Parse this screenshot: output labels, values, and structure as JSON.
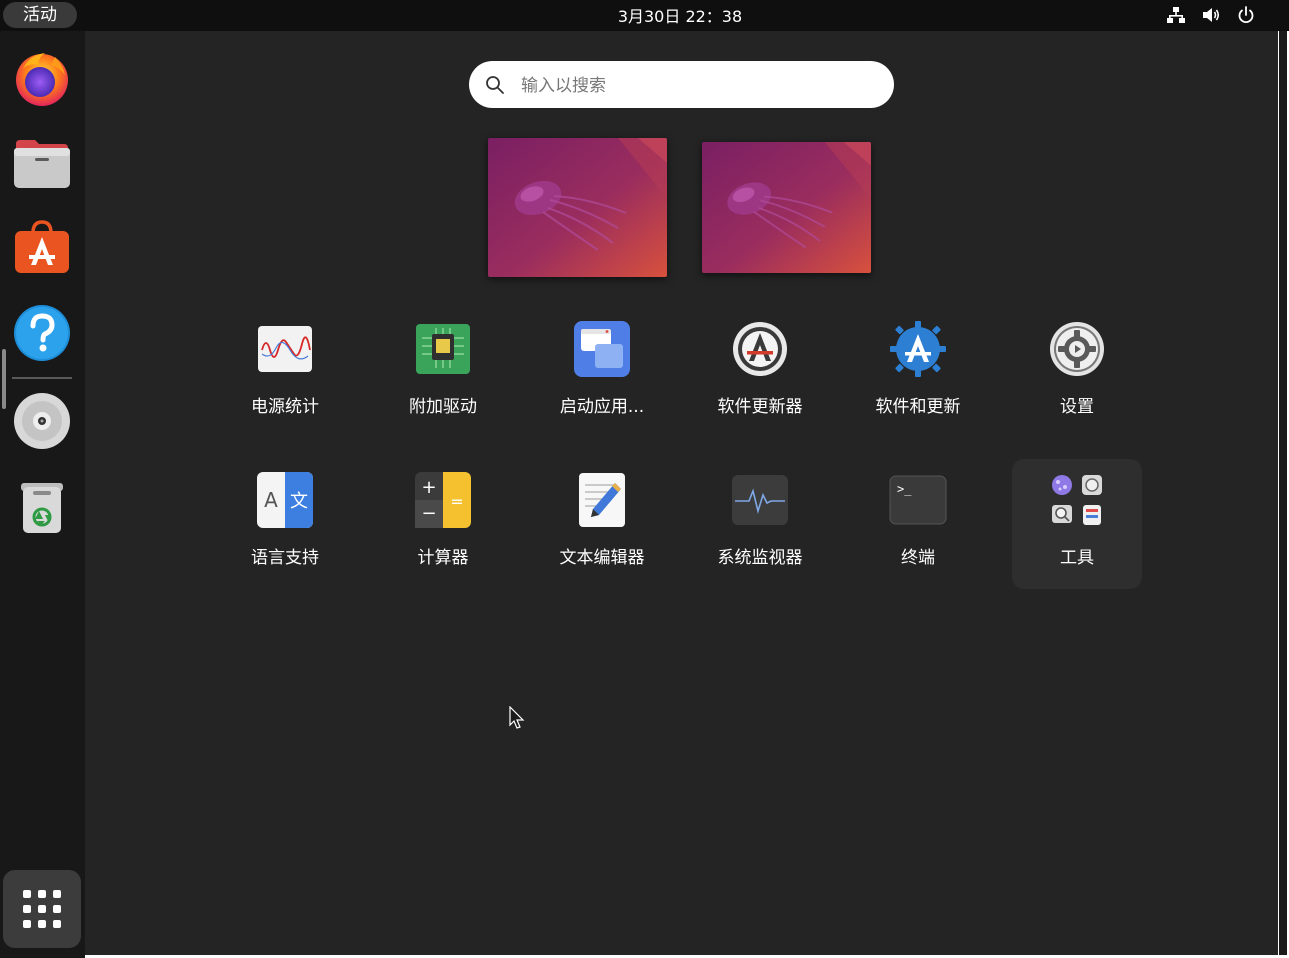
{
  "topbar": {
    "activities_label": "活动",
    "clock": "3月30日  22：38",
    "tray": [
      "network-icon",
      "volume-icon",
      "power-icon"
    ]
  },
  "dock": {
    "items": [
      "firefox-icon",
      "files-icon",
      "app-store-icon",
      "help-icon",
      "disc-icon",
      "trash-icon"
    ],
    "show_apps": "show-apps-grid-icon"
  },
  "search": {
    "placeholder": "输入以搜索"
  },
  "workspaces": [
    {
      "name": "workspace-1",
      "wallpaper": "jellyfish-purple"
    },
    {
      "name": "workspace-2",
      "wallpaper": "jellyfish-purple"
    }
  ],
  "apps": [
    {
      "label": "电源统计",
      "icon": "power-statistics-icon"
    },
    {
      "label": "附加驱动",
      "icon": "additional-drivers-icon"
    },
    {
      "label": "启动应用...",
      "icon": "startup-apps-icon"
    },
    {
      "label": "软件更新器",
      "icon": "software-updater-icon"
    },
    {
      "label": "软件和更新",
      "icon": "software-properties-icon"
    },
    {
      "label": "设置",
      "icon": "settings-icon"
    },
    {
      "label": "语言支持",
      "icon": "language-support-icon"
    },
    {
      "label": "计算器",
      "icon": "calculator-icon"
    },
    {
      "label": "文本编辑器",
      "icon": "text-editor-icon"
    },
    {
      "label": "系统监视器",
      "icon": "system-monitor-icon"
    },
    {
      "label": "终端",
      "icon": "terminal-icon"
    },
    {
      "label": "工具",
      "icon": "utilities-folder-icon"
    }
  ],
  "colors": {
    "background": "#242424",
    "topbar": "#0f0f0f",
    "dock": "#181818",
    "folder_bg": "#2e2e2e"
  }
}
